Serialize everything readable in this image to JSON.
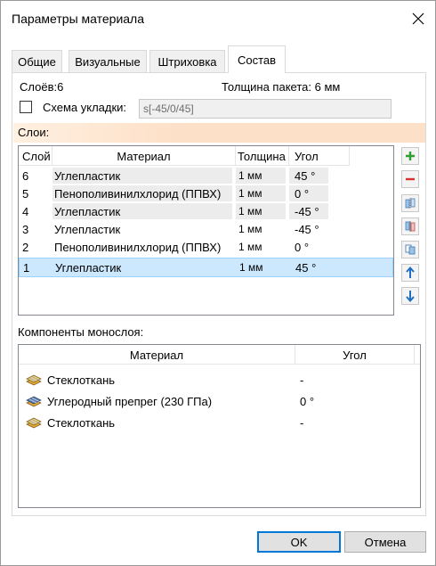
{
  "window": {
    "title": "Параметры материала"
  },
  "tabs": [
    {
      "label": "Общие"
    },
    {
      "label": "Визуальные"
    },
    {
      "label": "Штриховка"
    },
    {
      "label": "Состав"
    }
  ],
  "composition": {
    "layers_count": "Слоёв:6",
    "thickness": "Толщина пакета: 6 мм",
    "scheme_label": "Схема укладки:",
    "scheme_checked": false,
    "scheme_value": "s[-45/0/45]",
    "layers_header": "Слои:",
    "layer_columns": [
      "Слой",
      "Материал",
      "Толщина",
      "Угол"
    ],
    "layers": [
      {
        "n": "6",
        "material": "Углепластик",
        "thickness": "1 мм",
        "angle": "45 °"
      },
      {
        "n": "5",
        "material": "Пенополивинилхлорид (ППВХ)",
        "thickness": "1 мм",
        "angle": "0 °"
      },
      {
        "n": "4",
        "material": "Углепластик",
        "thickness": "1 мм",
        "angle": "-45 °"
      },
      {
        "n": "3",
        "material": "Углепластик",
        "thickness": "1 мм",
        "angle": "-45 °"
      },
      {
        "n": "2",
        "material": "Пенополивинилхлорид (ППВХ)",
        "thickness": "1 мм",
        "angle": "0 °"
      },
      {
        "n": "1",
        "material": "Углепластик",
        "thickness": "1 мм",
        "angle": "45 °"
      }
    ],
    "selected_layer": "1",
    "side_buttons": [
      "add-icon",
      "remove-icon",
      "mirror-icon",
      "flip-icon",
      "copy-icon",
      "arrow-up-icon",
      "arrow-down-icon"
    ],
    "components_label": "Компоненты монослоя:",
    "component_columns": [
      "Материал",
      "Угол"
    ],
    "components": [
      {
        "material": "Стеклоткань",
        "angle": "-"
      },
      {
        "material": "Углеродный препрег (230 ГПа)",
        "angle": "0 °"
      },
      {
        "material": "Стеклоткань",
        "angle": "-"
      }
    ]
  },
  "buttons": {
    "ok": "OK",
    "cancel": "Отмена"
  },
  "colors": {
    "add": "#2e9e2e",
    "remove": "#d9302f",
    "arrow": "#1f6fc5",
    "selection": "#cce8ff",
    "layers_header": "#fde0c8"
  }
}
